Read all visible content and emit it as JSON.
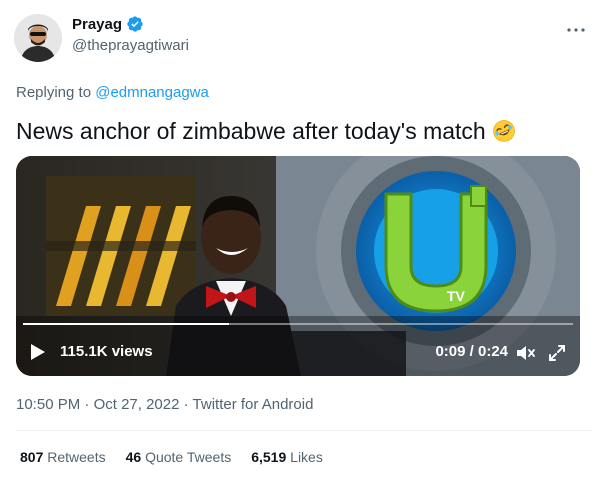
{
  "author": {
    "name": "Prayag",
    "handle": "@theprayagtiwari",
    "verified": true
  },
  "reply": {
    "prefix": "Replying to",
    "to": "@edmnangagwa"
  },
  "tweet": {
    "text": "News anchor of zimbabwe after today's match",
    "emoji": "rolling-on-floor-laughing"
  },
  "video": {
    "views": "115.1K views",
    "time": "0:09 / 0:24",
    "progress": 0.375,
    "logo_text": "TV"
  },
  "meta": {
    "time": "10:50 PM",
    "date": "Oct 27, 2022",
    "source": "Twitter for Android",
    "sep": "·"
  },
  "stats": {
    "retweets_count": "807",
    "retweets_label": "Retweets",
    "quotes_count": "46",
    "quotes_label": "Quote Tweets",
    "likes_count": "6,519",
    "likes_label": "Likes"
  },
  "colors": {
    "accent": "#1d9bf0",
    "muted": "#536471",
    "text": "#0f1419"
  }
}
